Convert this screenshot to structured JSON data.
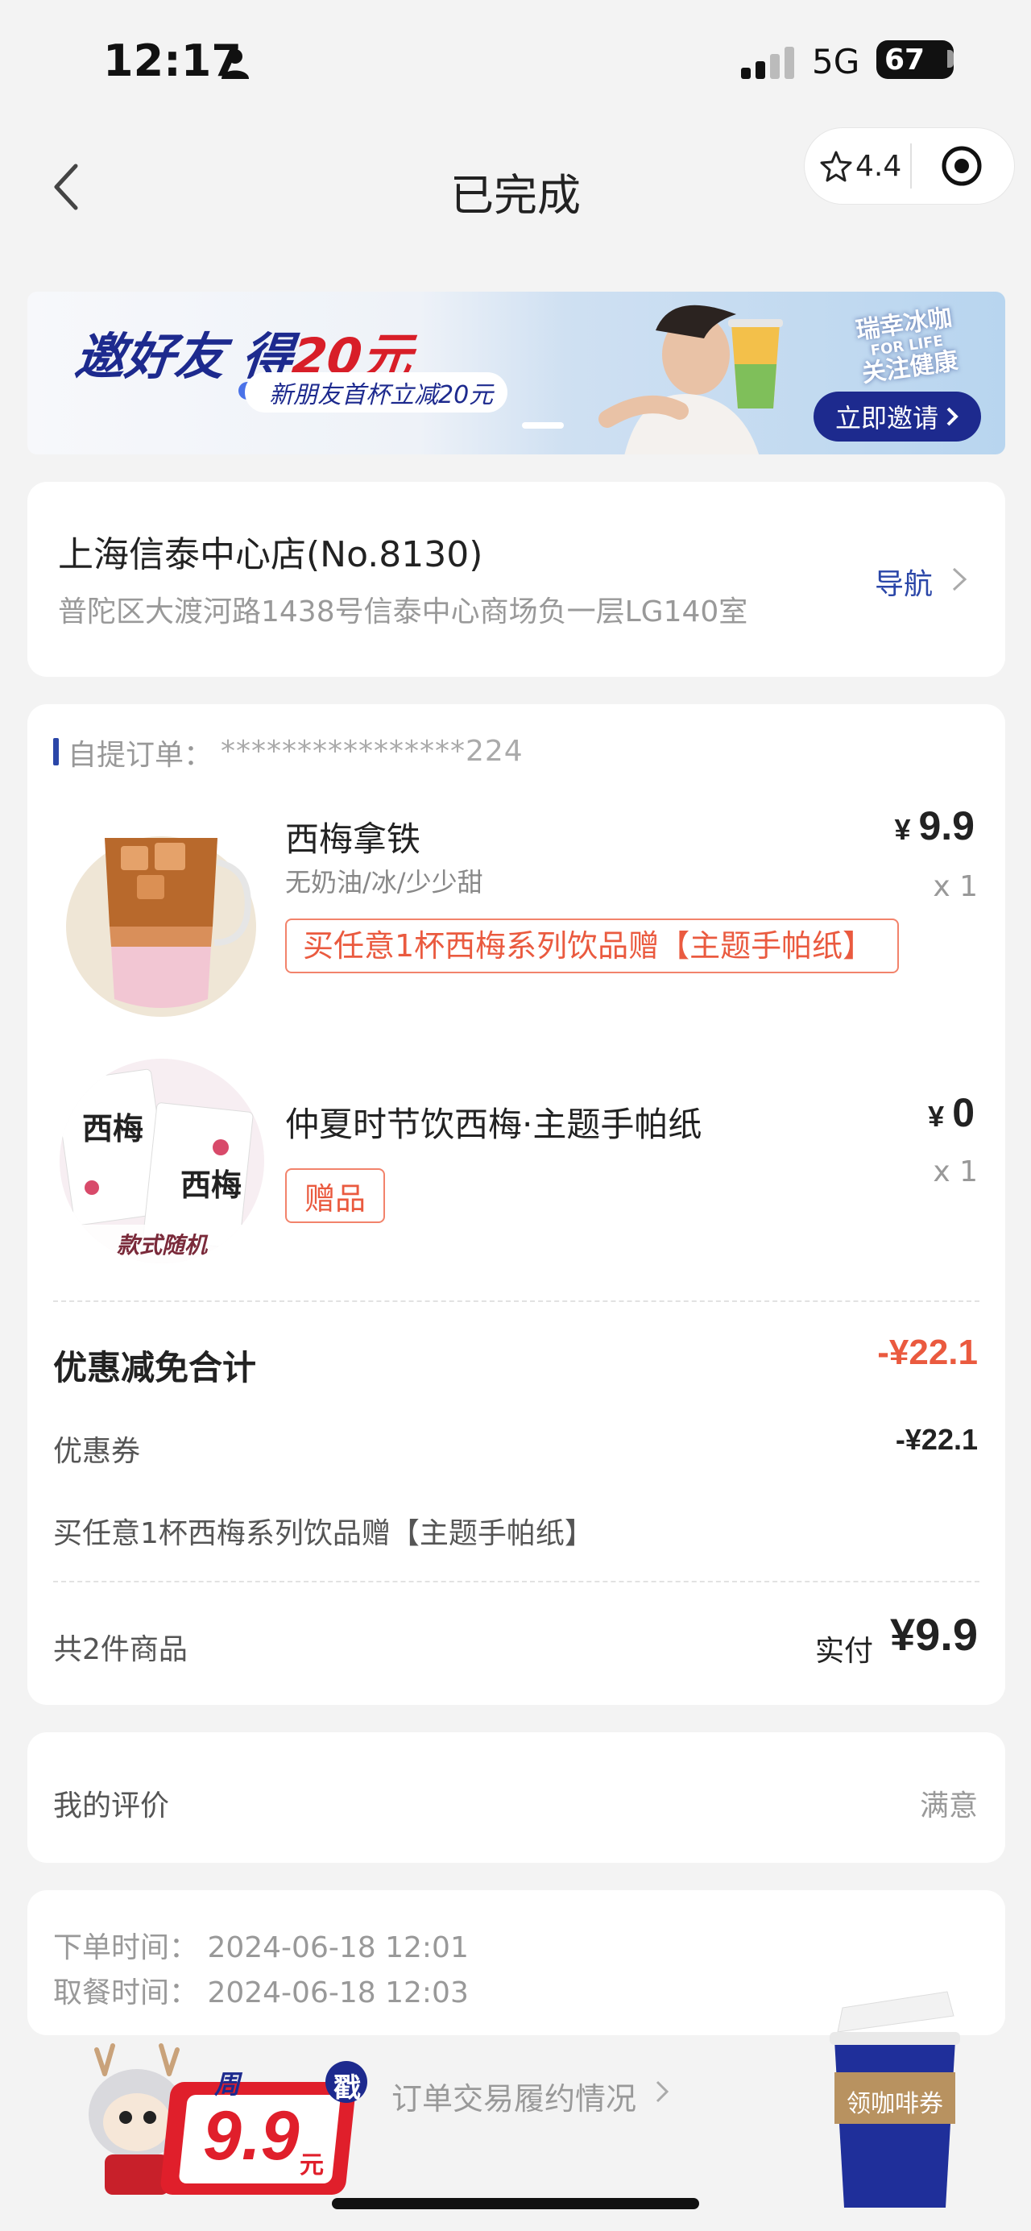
{
  "status_bar": {
    "time": "12:17",
    "network": "5G",
    "battery": "67"
  },
  "nav": {
    "title": "已完成",
    "rating": "4.4"
  },
  "banner": {
    "title_prefix": "邀好友 得",
    "title_highlight": "20元",
    "subtitle": "新朋友首杯立减20元",
    "tag_line1": "瑞幸冰咖",
    "tag_line2": "FOR LIFE",
    "tag_line3": "关注健康",
    "invite_button": "立即邀请"
  },
  "store": {
    "name": "上海信泰中心店(No.8130)",
    "address": "普陀区大渡河路1438号信泰中心商场负一层LG140室",
    "nav_label": "导航"
  },
  "order": {
    "label": "自提订单：",
    "number": "****************224",
    "items": [
      {
        "name": "西梅拿铁",
        "spec": "无奶油/冰/少少甜",
        "promo": "买任意1杯西梅系列饮品赠【主题手帕纸】",
        "price_symbol": "¥",
        "price": "9.9",
        "qty": "x 1"
      },
      {
        "name": "仲夏时节饮西梅·主题手帕纸",
        "tag": "赠品",
        "image_caption": "款式随机",
        "price_symbol": "¥",
        "price": "0",
        "qty": "x 1"
      }
    ],
    "discount_title": "优惠减免合计",
    "discount_total": "-¥22.1",
    "coupon_label": "优惠券",
    "coupon_value": "-¥22.1",
    "promo_line": "买任意1杯西梅系列饮品赠【主题手帕纸】",
    "item_count": "共2件商品",
    "paid_label": "实付",
    "paid_value": "¥9.9"
  },
  "review": {
    "label": "我的评价",
    "value": "满意"
  },
  "times": {
    "order_time": "下单时间：  2024-06-18 12:01",
    "pickup_time": "取餐时间：  2024-06-18 12:03"
  },
  "footer": {
    "fulfil_link": "订单交易履约情况",
    "promo_badge_week": "周",
    "promo_badge_stamp": "戳",
    "promo_badge_price": "9.9",
    "promo_badge_unit": "元",
    "coffee_coupon": "领咖啡券"
  },
  "colors": {
    "accent_blue": "#2a46a8",
    "accent_red": "#ea5a3f",
    "brand_navy": "#1d2a8e"
  }
}
